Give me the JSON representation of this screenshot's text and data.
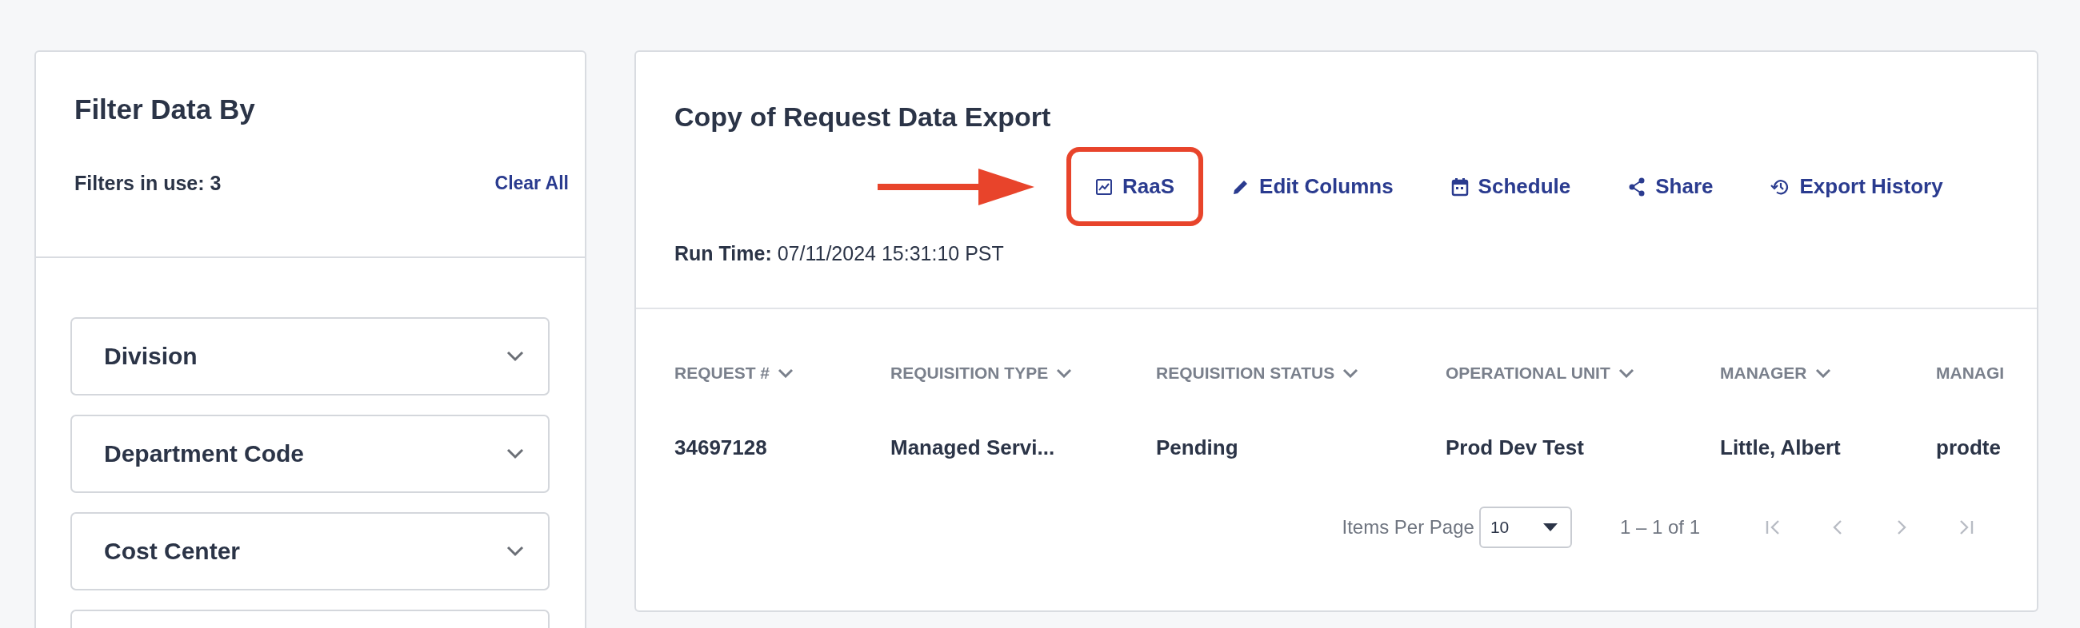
{
  "filter_panel": {
    "title": "Filter Data By",
    "filters_in_use": "Filters in use: 3",
    "clear_all": "Clear All",
    "filters": [
      {
        "label": "Division",
        "expanded": false
      },
      {
        "label": "Department Code",
        "expanded": false
      },
      {
        "label": "Cost Center",
        "expanded": false
      }
    ]
  },
  "report": {
    "title": "Copy of Request Data Export",
    "actions": [
      {
        "kind": "raas",
        "label": "RaaS",
        "highlighted": true
      },
      {
        "kind": "edit",
        "label": "Edit Columns",
        "highlighted": false
      },
      {
        "kind": "schedule",
        "label": "Schedule",
        "highlighted": false
      },
      {
        "kind": "share",
        "label": "Share",
        "highlighted": false
      },
      {
        "kind": "history",
        "label": "Export History",
        "highlighted": false
      }
    ],
    "run_time_label": "Run Time:",
    "run_time": "07/11/2024 15:31:10 PST",
    "table": {
      "columns": [
        {
          "label": "REQUEST #",
          "sort_icon": true
        },
        {
          "label": "REQUISITION TYPE",
          "sort_icon": true
        },
        {
          "label": "REQUISITION STATUS",
          "sort_icon": true
        },
        {
          "label": "OPERATIONAL UNIT",
          "sort_icon": true
        },
        {
          "label": "MANAGER",
          "sort_icon": true
        },
        {
          "label": "MANAGI",
          "sort_icon": false
        }
      ],
      "rows": [
        [
          "34697128",
          "Managed Servi...",
          "Pending",
          "Prod Dev Test",
          "Little, Albert",
          "prodte"
        ]
      ]
    },
    "pagination": {
      "items_per_page_label": "Items Per Page",
      "items_per_page": "10",
      "range": "1 – 1 of 1",
      "buttons": [
        {
          "kind": "first",
          "disabled": true
        },
        {
          "kind": "prev",
          "disabled": true
        },
        {
          "kind": "next",
          "disabled": true
        },
        {
          "kind": "last",
          "disabled": true
        }
      ]
    }
  }
}
